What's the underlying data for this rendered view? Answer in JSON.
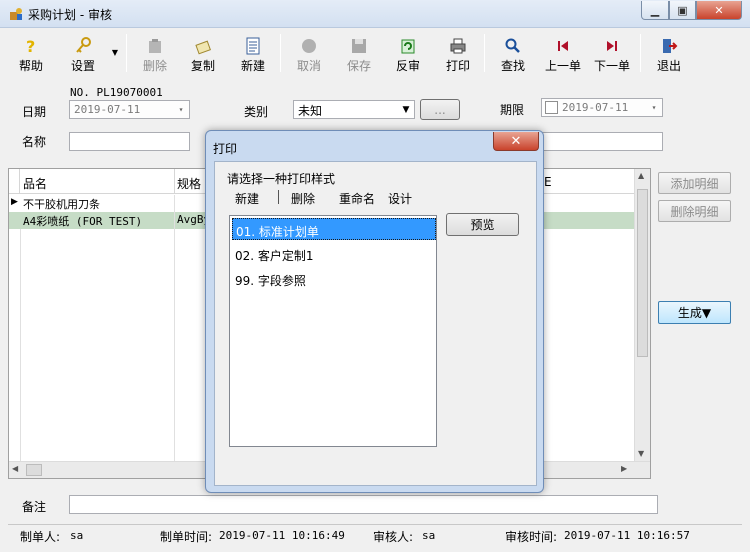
{
  "window": {
    "title": "采购计划 - 审核"
  },
  "toolbar": {
    "help": "帮助",
    "settings": "设置",
    "delete": "删除",
    "copy": "复制",
    "new": "新建",
    "cancel": "取消",
    "save": "保存",
    "unaudit": "反审",
    "print": "打印",
    "find": "查找",
    "prev": "上一单",
    "next": "下一单",
    "exit": "退出"
  },
  "form": {
    "doc_no": "NO. PL19070001",
    "date_label": "日期",
    "date_value": "2019-07-11",
    "category_label": "类别",
    "category_value": "未知",
    "ellipsis": "...",
    "deadline_label": "期限",
    "deadline_value": "2019-07-11",
    "name_label": "名称"
  },
  "grid": {
    "headers": [
      "品名",
      "规格"
    ],
    "header_right": "E",
    "rows": [
      {
        "name": "不干胶机用刀条",
        "spec": ""
      },
      {
        "name": "A4彩喷纸 (FOR TEST)",
        "spec": "AvgBy"
      }
    ]
  },
  "side": {
    "add_detail": "添加明细",
    "delete_detail": "删除明细",
    "generate": "生成▼"
  },
  "dialog": {
    "title": "打印",
    "prompt": "请选择一种打印样式",
    "menu": {
      "new": "新建",
      "delete": "删除",
      "rename": "重命名",
      "design": "设计"
    },
    "preview": "预览",
    "items": [
      "01. 标准计划单",
      "02. 客户定制1",
      "99. 字段参照"
    ]
  },
  "remarks_label": "备注",
  "status": {
    "creator_label": "制单人:",
    "creator": "sa",
    "create_time_label": "制单时间:",
    "create_time": "2019-07-11 10:16:49",
    "auditor_label": "审核人:",
    "auditor": "sa",
    "audit_time_label": "审核时间:",
    "audit_time": "2019-07-11 10:16:57"
  }
}
